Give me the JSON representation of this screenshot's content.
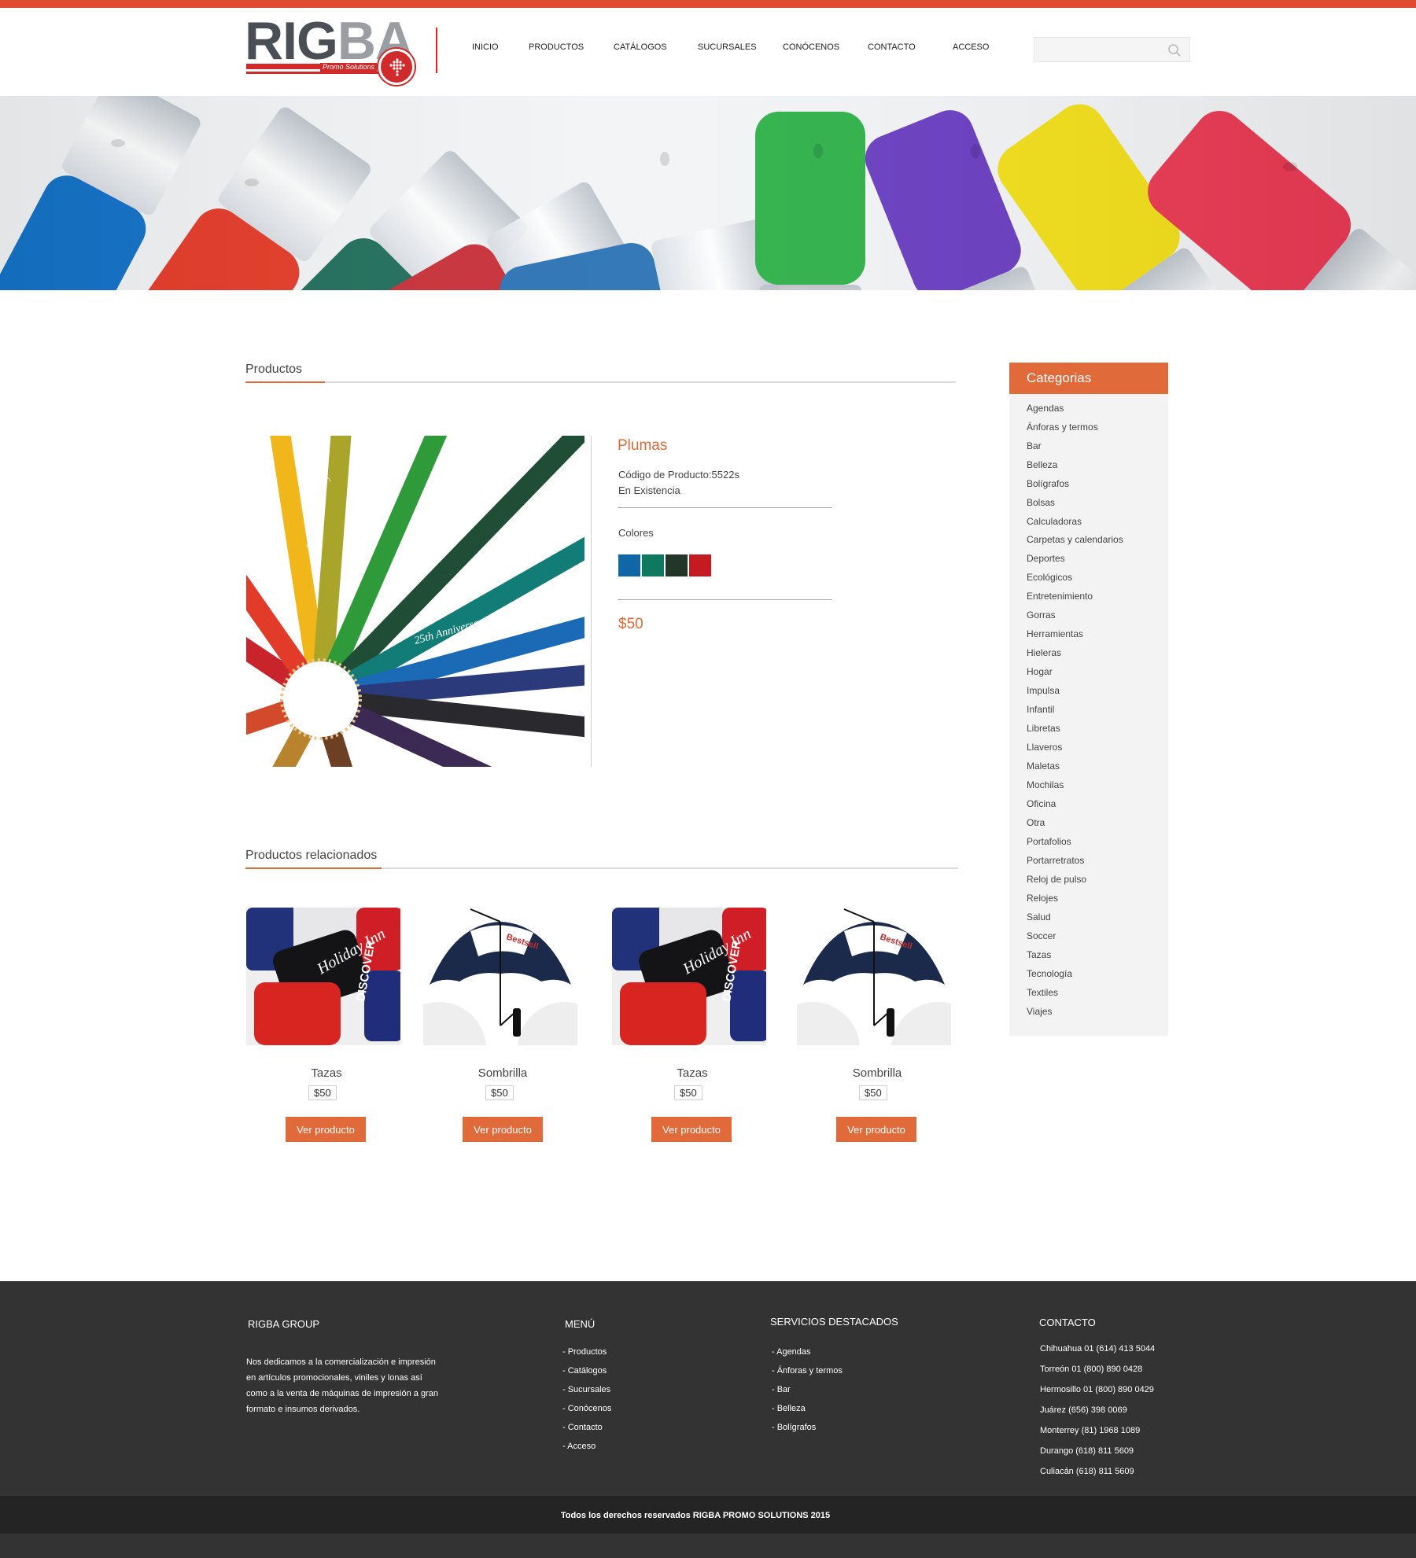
{
  "brand": {
    "logo_text_1": "RIG",
    "logo_text_2": "BA",
    "logo_tagline": "Promo Solutions",
    "accent_color": "#e06a3a",
    "brand_red": "#d12a2a"
  },
  "nav": {
    "items": [
      "INICIO",
      "PRODUCTOS",
      "CATÁLOGOS",
      "SUCURSALES",
      "CONÓCENOS",
      "CONTACTO",
      "ACCESO"
    ]
  },
  "search": {
    "placeholder": "",
    "value": "",
    "icon": "search-icon"
  },
  "main": {
    "section_title": "Productos",
    "product": {
      "name": "Plumas",
      "code": "Código de Producto:5522s",
      "stock": "En Existencia",
      "colors_label": "Colores",
      "colors": [
        "#0f67a7",
        "#0e7861",
        "#23362a",
        "#c41a21"
      ],
      "price": "$50",
      "image_text": "25th Anniversary"
    },
    "related_title": "Productos relacionados",
    "related": [
      {
        "name": "Tazas",
        "price": "$50",
        "button": "Ver producto",
        "image": "mugs"
      },
      {
        "name": "Sombrilla",
        "price": "$50",
        "button": "Ver producto",
        "image": "umbrella"
      },
      {
        "name": "Tazas",
        "price": "$50",
        "button": "Ver producto",
        "image": "mugs"
      },
      {
        "name": "Sombrilla",
        "price": "$50",
        "button": "Ver producto",
        "image": "umbrella"
      }
    ]
  },
  "sidebar": {
    "title": "Categorias",
    "items": [
      "Agendas",
      "Ánforas y termos",
      "Bar",
      "Belleza",
      "Bolígrafos",
      "Bolsas",
      "Calculadoras",
      "Carpetas y calendarios",
      "Deportes",
      "Ecológicos",
      "Entretenimiento",
      "Gorras",
      "Herramientas",
      "Hieleras",
      "Hogar",
      "Impulsa",
      "Infantil",
      "Libretas",
      "Llaveros",
      "Maletas",
      "Mochilas",
      "Oficina",
      "Otra",
      "Portafolios",
      "Portarretratos",
      "Reloj de pulso",
      "Relojes",
      "Salud",
      "Soccer",
      "Tazas",
      "Tecnología",
      "Textiles",
      "Viajes"
    ]
  },
  "footer": {
    "about_title": "RIGBA GROUP",
    "about_text": [
      "Nos dedicamos a la comercialización e impresión",
      "en artículos promocionales, viniles y lonas así",
      "como a la venta de máquinas de impresión a gran",
      "formato e insumos derivados."
    ],
    "menu_title": "MENÚ",
    "menu_items": [
      "- Productos",
      "- Catálogos",
      "- Sucursales",
      "- Conócenos",
      "- Contacto",
      "- Acceso"
    ],
    "services_title": "SERVICIOS DESTACADOS",
    "services_items": [
      "- Agendas",
      "- Ánforas y termos",
      "- Bar",
      "- Belleza",
      "- Bolígrafos"
    ],
    "contact_title": "CONTACTO",
    "contact_items": [
      "Chihuahua 01 (614) 413 5044",
      "Torreón 01 (800) 890 0428",
      "Hermosillo 01 (800) 890 0429",
      "Juárez (656) 398 0069",
      "Monterrey (81) 1968 1089",
      "Durango (618) 811 5609",
      "Culiacán (618) 811 5609"
    ],
    "copyright": "Todos los derechos reservados RIGBA PROMO SOLUTIONS 2015"
  }
}
